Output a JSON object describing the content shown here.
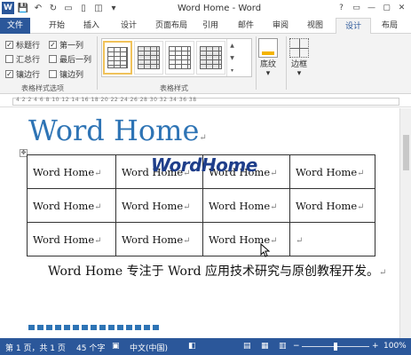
{
  "window": {
    "title": "Word Home - Word",
    "controls": [
      "?",
      "▭",
      "—",
      "▢",
      "✕"
    ]
  },
  "tabs": [
    "文件",
    "开始",
    "插入",
    "设计",
    "页面布局",
    "引用",
    "邮件",
    "审阅",
    "视图",
    "设计",
    "布局"
  ],
  "ribbon": {
    "options": [
      {
        "label": "标题行",
        "checked": true
      },
      {
        "label": "第一列",
        "checked": true
      },
      {
        "label": "汇总行",
        "checked": false
      },
      {
        "label": "最后一列",
        "checked": false
      },
      {
        "label": "镶边行",
        "checked": true
      },
      {
        "label": "镶边列",
        "checked": false
      }
    ],
    "group_options_label": "表格样式选项",
    "group_styles_label": "表格样式",
    "shading_label": "底纹",
    "borders_label": "边框"
  },
  "ruler": {
    "ticks": "4  2    2  4  6  8  10  12  14  16  18  20  22  24  26  28  30  32  34  36  38"
  },
  "document": {
    "title": "Word Home",
    "table": [
      [
        "Word Home",
        "Word Home",
        "Word Home",
        "Word Home"
      ],
      [
        "Word Home",
        "Word Home",
        "Word Home",
        "Word Home"
      ],
      [
        "Word Home",
        "Word Home",
        "Word Home",
        ""
      ]
    ],
    "watermark": "WordHome",
    "paragraph": "Word Home 专注于 Word 应用技术研究与原创教程开发。",
    "para_mark": "↵"
  },
  "status": {
    "page": "第 1 页，共 1 页",
    "words": "45 个字",
    "language": "中文(中国)",
    "zoom": "100%"
  },
  "colors": {
    "accent": "#2b579a",
    "heading": "#2e74b5"
  }
}
